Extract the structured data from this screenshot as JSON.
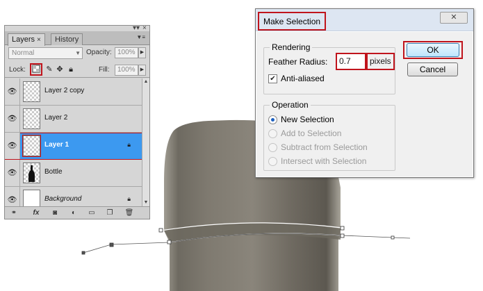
{
  "layers_panel": {
    "tabs": [
      {
        "label": "Layers",
        "active": true,
        "close": "×"
      },
      {
        "label": "History",
        "active": false
      }
    ],
    "window_controls": {
      "collapse": "▾▾",
      "close": "×"
    },
    "panel_menu": "▼≡",
    "blend_mode": "Normal",
    "opacity_label": "Opacity:",
    "opacity_value": "100%",
    "lock_label": "Lock:",
    "fill_label": "Fill:",
    "fill_value": "100%",
    "layers": [
      {
        "name": "Layer 2 copy",
        "visible": true,
        "selected": false,
        "locked": false
      },
      {
        "name": "Layer 2",
        "visible": true,
        "selected": false,
        "locked": false
      },
      {
        "name": "Layer 1",
        "visible": true,
        "selected": true,
        "locked": true
      },
      {
        "name": "Bottle",
        "visible": true,
        "selected": false,
        "locked": false
      },
      {
        "name": "Background",
        "visible": true,
        "selected": false,
        "locked": true
      }
    ],
    "bottom_icons": [
      "link-layers-icon",
      "fx-icon",
      "layer-mask-icon",
      "adjustment-layer-icon",
      "new-group-icon",
      "new-layer-icon",
      "trash-icon"
    ]
  },
  "dialog": {
    "title": "Make Selection",
    "close_glyph": "✕",
    "rendering": {
      "legend": "Rendering",
      "feather_label": "Feather Radius:",
      "feather_value": "0.7",
      "units": "pixels",
      "anti_aliased_label": "Anti-aliased",
      "anti_aliased_checked": true
    },
    "operation": {
      "legend": "Operation",
      "options": [
        {
          "label": "New Selection",
          "selected": true,
          "enabled": true
        },
        {
          "label": "Add to Selection",
          "selected": false,
          "enabled": false
        },
        {
          "label": "Subtract from Selection",
          "selected": false,
          "enabled": false
        },
        {
          "label": "Intersect with Selection",
          "selected": false,
          "enabled": false
        }
      ]
    },
    "ok_label": "OK",
    "cancel_label": "Cancel"
  },
  "colors": {
    "highlight_red": "#c0141c",
    "selection_blue": "#3c99f0",
    "bottle_gray": "#7a756c"
  }
}
